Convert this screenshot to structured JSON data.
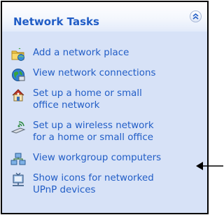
{
  "panel": {
    "title": "Network Tasks",
    "tasks": [
      {
        "label": "Add a network place",
        "icon": "network-place-icon"
      },
      {
        "label": "View network connections",
        "icon": "network-connections-icon"
      },
      {
        "label": "Set up a home or small\noffice network",
        "icon": "home-network-icon"
      },
      {
        "label": "Set up a wireless network\nfor a home or small office",
        "icon": "wireless-network-icon"
      },
      {
        "label": "View workgroup computers",
        "icon": "workgroup-computers-icon"
      },
      {
        "label": "Show icons for networked\nUPnP devices",
        "icon": "upnp-devices-icon"
      }
    ]
  },
  "colors": {
    "link": "#215dc6",
    "panel_body": "#d7e2f7",
    "border": "#000000"
  }
}
